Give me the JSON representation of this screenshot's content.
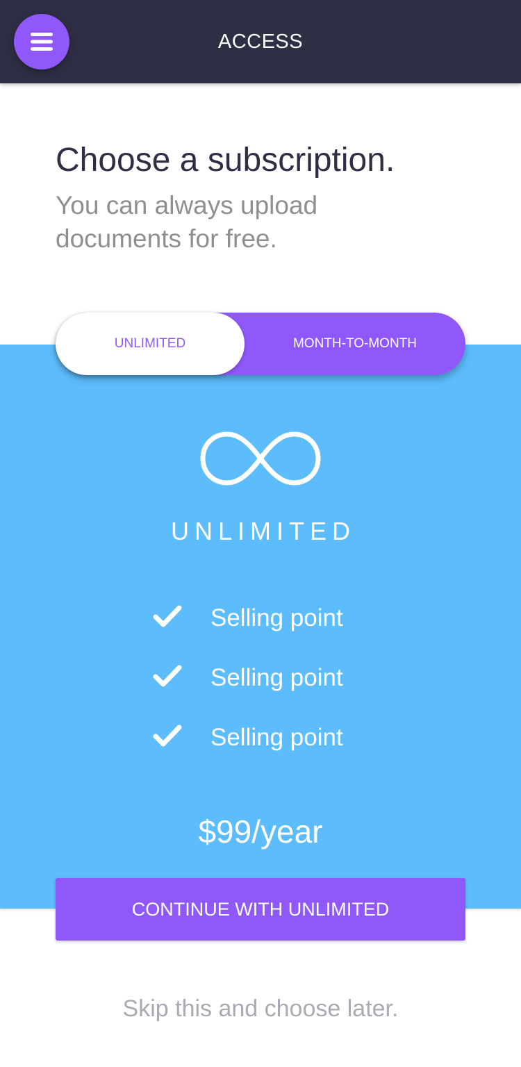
{
  "header": {
    "menu_icon": "hamburger-menu-icon",
    "title": "ACCESS"
  },
  "intro": {
    "headline": "Choose a subscription.",
    "subtext": "You can always upload documents for free."
  },
  "plan_toggle": {
    "options": [
      {
        "label": "UNLIMITED",
        "selected": true
      },
      {
        "label": "MONTH-TO-MONTH",
        "selected": false
      }
    ]
  },
  "plan": {
    "icon": "infinity-icon",
    "name": "UNLIMITED",
    "features": [
      {
        "icon": "checkmark-icon",
        "text": "Selling point"
      },
      {
        "icon": "checkmark-icon",
        "text": "Selling point"
      },
      {
        "icon": "checkmark-icon",
        "text": "Selling point"
      }
    ],
    "price": "$99/year"
  },
  "actions": {
    "continue_label": "CONTINUE WITH UNLIMITED",
    "skip_label": "Skip this and choose later."
  },
  "colors": {
    "header_bg": "#2e2f45",
    "accent_purple": "#9058fb",
    "panel_blue": "#5dbcfc",
    "muted_text": "#8e8e93"
  }
}
